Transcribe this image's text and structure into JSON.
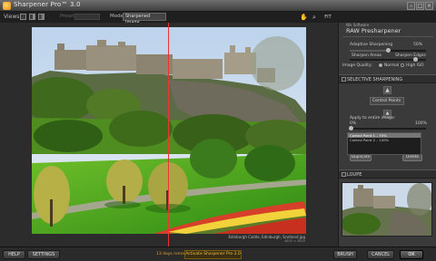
{
  "window": {
    "title": "Sharpener Pro™ 3.0"
  },
  "toolbar": {
    "views_label": "Views:",
    "preset_label": "Presets",
    "mode_label": "Mode:",
    "mode_value": "Sharpened Image"
  },
  "canvas": {
    "caption": "Edinburgh Castle, Edinburgh, Scotland.jpg",
    "zoom_label": "FIT"
  },
  "panel": {
    "brand": "Nik Software",
    "title": "RAW Presharpener",
    "adaptive_label": "Adaptive Sharpening",
    "adaptive_value": "50%",
    "sharpen_areas_label": "Sharpen Areas",
    "sharpen_edges_label": "Sharpen Edges",
    "image_quality_label": "Image Quality:",
    "quality_normal": "Normal",
    "quality_high": "High ISO",
    "selective_label": "SELECTIVE SHARPENING",
    "control_points_label": "Control Points",
    "apply_label": "Apply to entire image:",
    "apply_min": "0%",
    "apply_max": "100%",
    "control_points": [
      {
        "label": "Control Point 1 – 70%",
        "selected": true
      },
      {
        "label": "Control Point 2 – 100%",
        "selected": false
      }
    ],
    "duplicate_label": "Duplicate",
    "delete_label": "Delete",
    "loupe_label": "LOUPE"
  },
  "statusbar": {
    "help_label": "HELP",
    "settings_label": "SETTINGS",
    "trial_text": "13 days remaining",
    "activate_label": "Activate Sharpener Pro 3.0",
    "brush_label": "BRUSH",
    "cancel_label": "CANCEL",
    "ok_label": "OK"
  },
  "colors": {
    "split_line": "#e33333",
    "accent": "#f2c04a"
  }
}
